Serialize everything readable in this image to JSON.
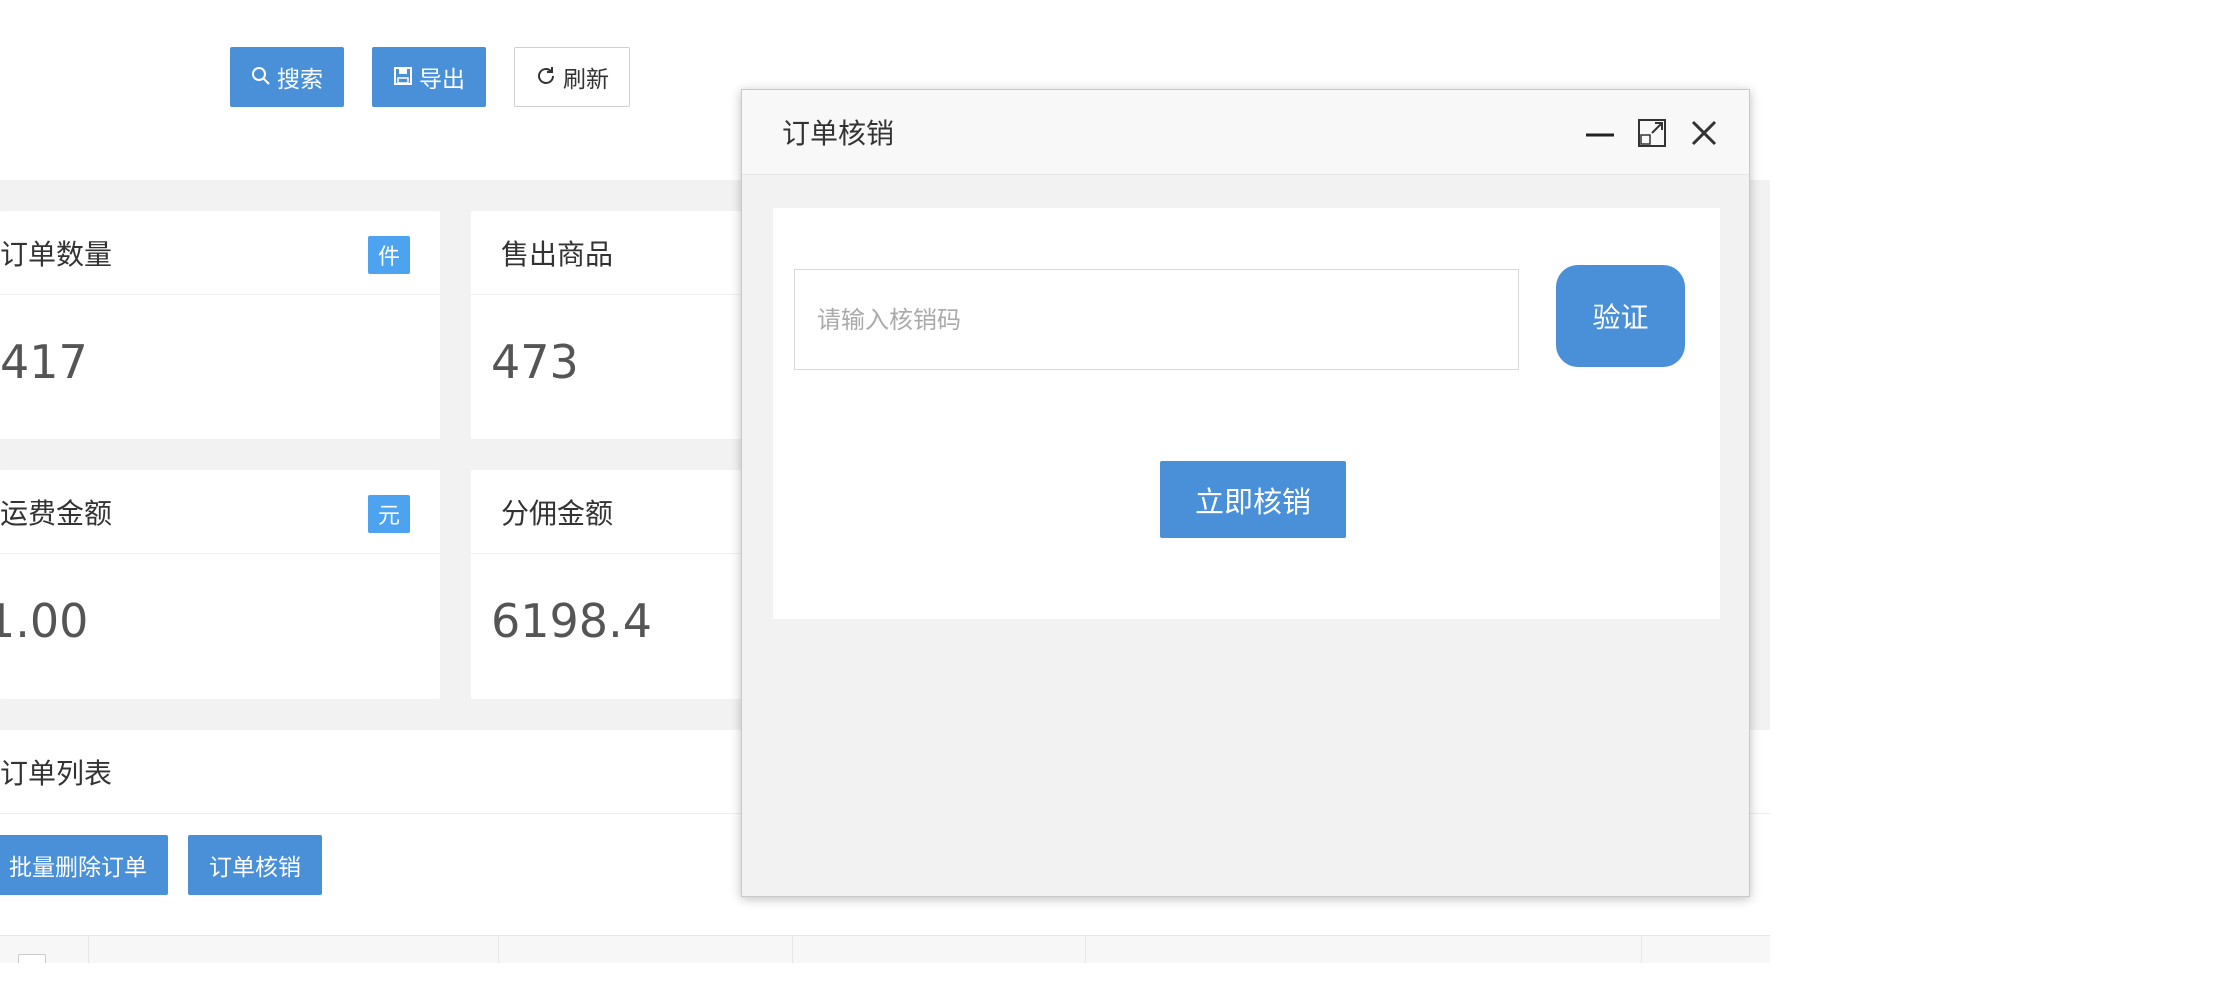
{
  "toolbar": {
    "search_label": "搜索",
    "search_icon": "search-icon",
    "export_label": "导出",
    "export_icon": "save-icon",
    "refresh_label": "刷新",
    "refresh_icon": "refresh-icon"
  },
  "stats": {
    "order_count": {
      "title": "订单数量",
      "badge": "件",
      "value": "417"
    },
    "items_sold": {
      "title": "售出商品",
      "value": "473"
    },
    "shipping_amount": {
      "title": "运费金额",
      "badge": "元",
      "value": "1.00"
    },
    "commission_amount": {
      "title": "分佣金额",
      "value": "6198.4"
    }
  },
  "order_list": {
    "title": "订单列表",
    "batch_delete_label": "批量删除订单",
    "verify_order_label": "订单核销"
  },
  "modal": {
    "title": "订单核销",
    "code_input_placeholder": "请输入核销码",
    "code_input_value": "",
    "verify_label": "验证",
    "submit_label": "立即核销",
    "controls": [
      "minimize-icon",
      "maximize-icon",
      "close-icon"
    ]
  },
  "colors": {
    "primary": "#4a90d9",
    "badge": "#4da3f0",
    "background": "#f2f2f2"
  }
}
